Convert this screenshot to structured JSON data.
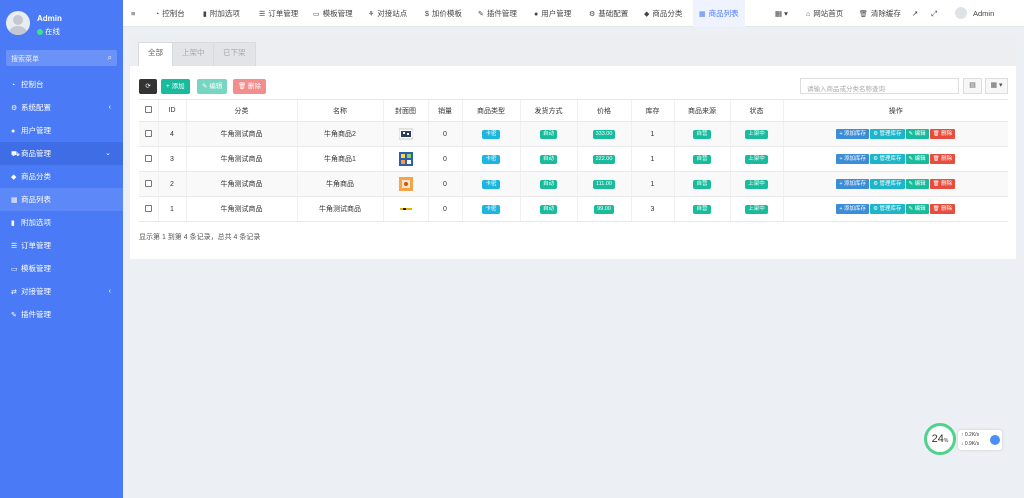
{
  "sidebar": {
    "user": {
      "name": "Admin",
      "status": "在线"
    },
    "search_placeholder": "搜索菜单",
    "items": [
      {
        "label": "控制台",
        "icon": "dashboard-icon"
      },
      {
        "label": "系统配置",
        "icon": "gear-icon",
        "caret": "‹"
      },
      {
        "label": "用户管理",
        "icon": "user-icon"
      },
      {
        "label": "商品管理",
        "icon": "cart-icon",
        "caret": "⌄"
      },
      {
        "label": "商品分类",
        "icon": "tag-icon"
      },
      {
        "label": "商品列表",
        "icon": "list-icon"
      },
      {
        "label": "附加选项",
        "icon": "bookmark-icon"
      },
      {
        "label": "订单管理",
        "icon": "order-icon"
      },
      {
        "label": "模板管理",
        "icon": "template-icon"
      },
      {
        "label": "对接管理",
        "icon": "link-icon",
        "caret": "‹"
      },
      {
        "label": "插件管理",
        "icon": "plugin-icon"
      }
    ]
  },
  "topbar": {
    "menu_icon": "≡",
    "nav": [
      "控制台",
      "附加选项",
      "订单管理",
      "模板管理",
      "对接站点",
      "加价模板",
      "插件管理",
      "用户管理",
      "基础配置",
      "商品分类",
      "商品列表"
    ],
    "right": {
      "site_home": "网站首页",
      "clear_cache": "清除缓存",
      "user": "Admin"
    }
  },
  "tabs": [
    "全部",
    "上架中",
    "已下架"
  ],
  "toolbar": {
    "refresh_label": "⟳",
    "add_label": "+ 添加",
    "edit_label": "✎ 编辑",
    "delete_label": "🗑 删除",
    "search_placeholder": "请输入商品或分类名称查询"
  },
  "table": {
    "columns": [
      "ID",
      "分类",
      "名称",
      "封面图",
      "销量",
      "商品类型",
      "发货方式",
      "价格",
      "库存",
      "商品来源",
      "状态",
      "操作"
    ],
    "rows": [
      {
        "id": "4",
        "category": "牛角测试商品",
        "name": "牛角商品2",
        "sales": "0",
        "type": "卡密",
        "delivery": "自动",
        "price": "333.00",
        "stock": "1",
        "source": "自营",
        "status": "上架中",
        "thumb": "qr"
      },
      {
        "id": "3",
        "category": "牛角测试商品",
        "name": "牛角商品1",
        "sales": "0",
        "type": "卡密",
        "delivery": "自动",
        "price": "222.00",
        "stock": "1",
        "source": "自营",
        "status": "上架中",
        "thumb": "grid"
      },
      {
        "id": "2",
        "category": "牛角测试商品",
        "name": "牛角商品",
        "sales": "0",
        "type": "卡密",
        "delivery": "自动",
        "price": "111.00",
        "stock": "1",
        "source": "自营",
        "status": "上架中",
        "thumb": "box"
      },
      {
        "id": "1",
        "category": "牛角测试商品",
        "name": "牛角测试商品",
        "sales": "0",
        "type": "卡密",
        "delivery": "自动",
        "price": "99.00",
        "stock": "3",
        "source": "自营",
        "status": "上架中",
        "thumb": "logo"
      }
    ],
    "ops": [
      "+ 添加库存",
      "⚙ 管理库存",
      "✎ 编辑",
      "🗑 删除"
    ]
  },
  "pagination_info": "显示第 1 到第 4 条记录，总共 4 条记录",
  "speed_widget": {
    "percent": "24",
    "unit": "%",
    "up": "0.2K/s",
    "down": "0.9K/s"
  }
}
